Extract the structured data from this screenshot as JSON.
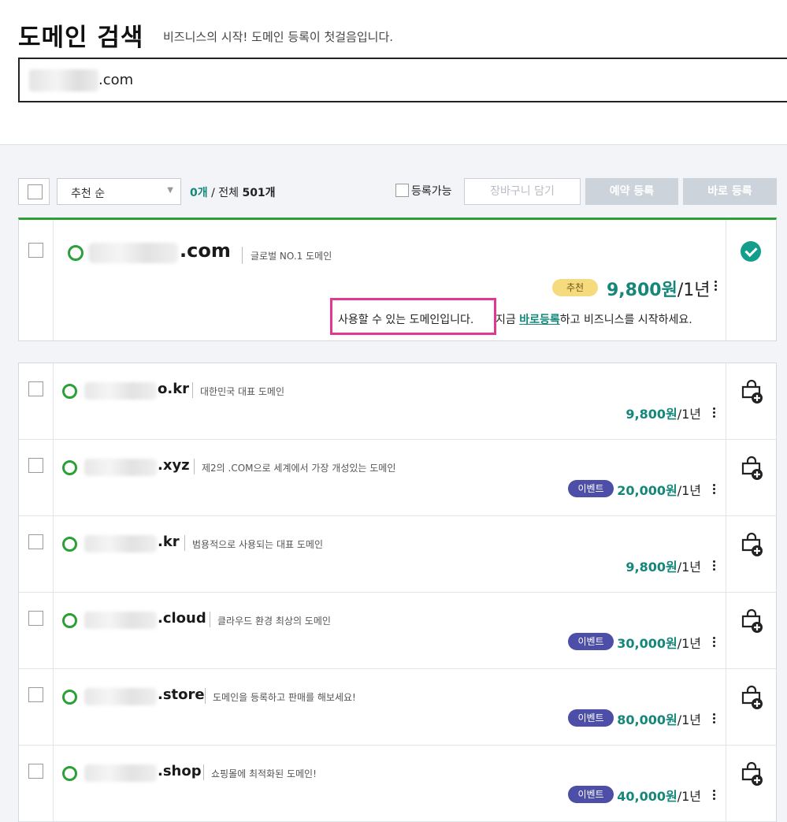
{
  "header": {
    "title": "도메인 검색",
    "subtitle": "비즈니스의 시작! 도메인 등록이 첫걸음입니다."
  },
  "search": {
    "value_suffix": ".com"
  },
  "toolbar": {
    "sort_label": "추천 순",
    "selected_count": "0개",
    "total_label": " / 전체 ",
    "total_count": "501개",
    "available_filter_label": "등록가능",
    "add_cart_label": "장바구니 담기",
    "reserve_label": "예약 등록",
    "register_label": "바로 등록"
  },
  "main_result": {
    "tld": ".com",
    "description": "글로벌 NO.1 도메인",
    "badge": "추천",
    "price": "9,800원",
    "period": "/1년",
    "available_message": "사용할 수 있는 도메인입니다.",
    "cta_prefix": " 지금 ",
    "cta_link": "바로등록",
    "cta_suffix": "하고 비즈니스를 시작하세요."
  },
  "results": [
    {
      "tld": "o.kr",
      "description": "대한민국 대표 도메인",
      "badge": "",
      "price": "9,800원",
      "period": "/1년"
    },
    {
      "tld": ".xyz",
      "description": "제2의 .COM으로 세계에서 가장 개성있는 도메인",
      "badge": "이벤트",
      "price": "20,000원",
      "period": "/1년"
    },
    {
      "tld": ".kr",
      "description": "범용적으로 사용되는 대표 도메인",
      "badge": "",
      "price": "9,800원",
      "period": "/1년"
    },
    {
      "tld": ".cloud",
      "description": "클라우드 환경 최상의 도메인",
      "badge": "이벤트",
      "price": "30,000원",
      "period": "/1년"
    },
    {
      "tld": ".store",
      "description": "도메인을 등록하고 판매를 해보세요!",
      "badge": "이벤트",
      "price": "80,000원",
      "period": "/1년"
    },
    {
      "tld": ".shop",
      "description": "쇼핑몰에 최적화된 도메인!",
      "badge": "이벤트",
      "price": "40,000원",
      "period": "/1년"
    }
  ],
  "colors": {
    "accent_teal": "#14877a",
    "status_green": "#2aa036",
    "event_badge": "#4c4ea8",
    "recommend_badge": "#f5da7e",
    "highlight_box": "#e0398f"
  },
  "icons": {
    "available": "ring-icon",
    "selected": "check-circle-icon",
    "add_cart": "cart-plus-icon",
    "more": "kebab-icon",
    "dropdown": "caret-down-icon"
  }
}
